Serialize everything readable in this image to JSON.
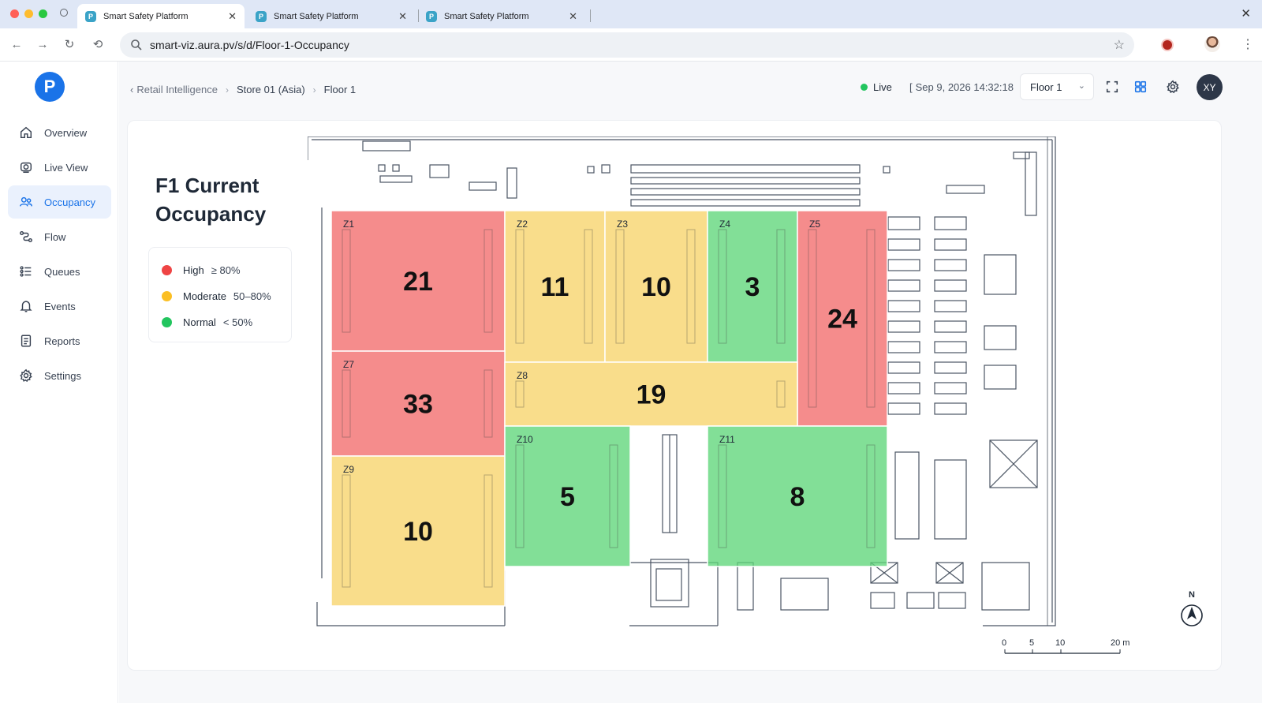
{
  "browser": {
    "tabs": [
      {
        "label": "Smart Safety Platform",
        "favicon": "P"
      },
      {
        "label": "Smart Safety Platform",
        "favicon": "P"
      },
      {
        "label": "Smart Safety Platform",
        "favicon": "P"
      }
    ],
    "url": "smart-viz.aura.pv/s/d/Floor-1-Occupancy"
  },
  "app": {
    "logo": "P"
  },
  "sidebar": {
    "items": [
      {
        "label": "Overview",
        "icon": "home-icon"
      },
      {
        "label": "Live View",
        "icon": "camera-icon"
      },
      {
        "label": "Occupancy",
        "icon": "people-icon",
        "active": true
      },
      {
        "label": "Flow",
        "icon": "flow-icon"
      },
      {
        "label": "Queues",
        "icon": "queue-icon"
      },
      {
        "label": "Events",
        "icon": "bell-icon"
      },
      {
        "label": "Reports",
        "icon": "report-icon"
      },
      {
        "label": "Settings",
        "icon": "gear-icon"
      }
    ]
  },
  "header": {
    "breadcrumb": [
      "Retail Intelligence",
      "Store 01 (Asia)",
      "Floor 1"
    ],
    "live": "Live",
    "timestamp": "Sep 9, 2026 14:32:18",
    "floor_select": "Floor 1",
    "avatar": "XY"
  },
  "page": {
    "title": "F1 Current Occupancy"
  },
  "legend": [
    {
      "label": "High",
      "range": "≥ 80%",
      "color": "#ef4444"
    },
    {
      "label": "Moderate",
      "range": "50–80%",
      "color": "#fbbf24"
    },
    {
      "label": "Normal",
      "range": "< 50%",
      "color": "#22c55e"
    }
  ],
  "zones": [
    {
      "id": "Z1",
      "count": "21",
      "level": "high"
    },
    {
      "id": "Z2",
      "count": "11",
      "level": "moderate"
    },
    {
      "id": "Z3",
      "count": "10",
      "level": "moderate"
    },
    {
      "id": "Z4",
      "count": "3",
      "level": "normal"
    },
    {
      "id": "Z5",
      "count": "24",
      "level": "high"
    },
    {
      "id": "Z7",
      "count": "33",
      "level": "high"
    },
    {
      "id": "Z8",
      "count": "19",
      "level": "moderate"
    },
    {
      "id": "Z9",
      "count": "10",
      "level": "moderate"
    },
    {
      "id": "Z10",
      "count": "5",
      "level": "normal"
    },
    {
      "id": "Z11",
      "count": "8",
      "level": "normal"
    }
  ],
  "scale_bar": [
    "0",
    "5",
    "10",
    "20 m"
  ],
  "compass": "N",
  "colors": {
    "accent": "#1a73e8",
    "high_fill": "#f26b6b",
    "moderate_fill": "#f7d46a",
    "normal_fill": "#5fd67a"
  }
}
